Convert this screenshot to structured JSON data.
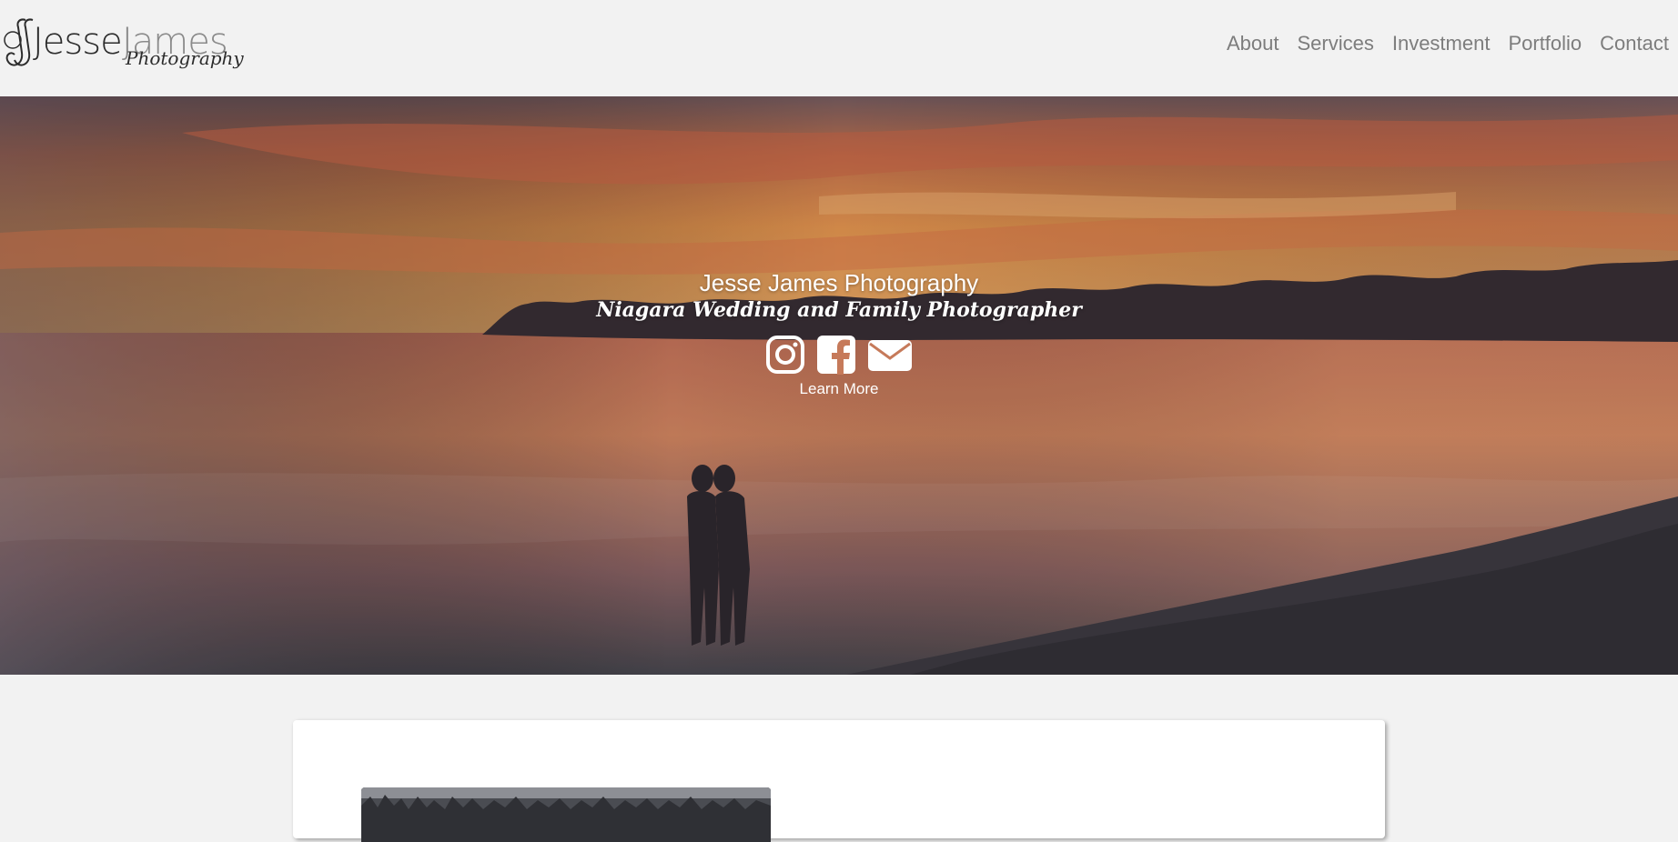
{
  "brand": {
    "logo_word_first": "Jesse",
    "logo_word_second": "James",
    "logo_script": "Photography",
    "colors": {
      "dark": "#2c2c2c",
      "grey": "#8a8a8a"
    }
  },
  "nav": {
    "items": [
      {
        "label": "About"
      },
      {
        "label": "Services"
      },
      {
        "label": "Investment"
      },
      {
        "label": "Portfolio"
      },
      {
        "label": "Contact"
      }
    ],
    "color": "#7d7d7d"
  },
  "hero": {
    "title": "Jesse James Photography",
    "subtitle": "Niagara Wedding and Family Photographer",
    "social_icons": [
      "instagram-icon",
      "facebook-icon",
      "email-icon"
    ],
    "cta_label": "Learn More",
    "image_description_colors": {
      "sky": "#e38a4c",
      "water": "#c97a5c"
    }
  },
  "page": {
    "background": "#f2f2f2",
    "card_background": "#ffffff"
  }
}
